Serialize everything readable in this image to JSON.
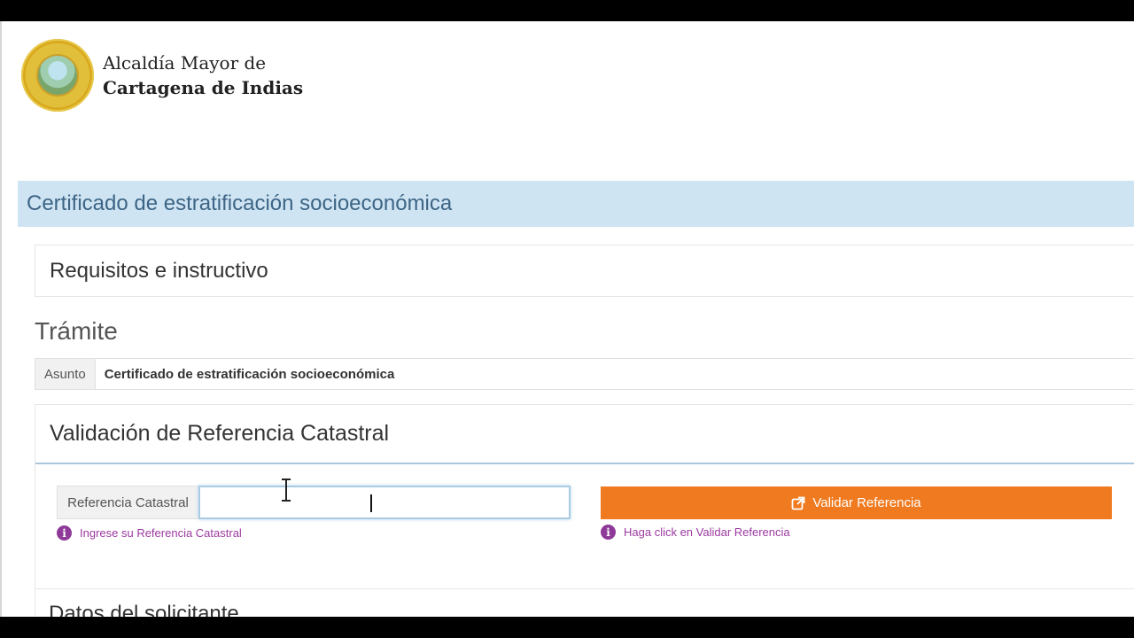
{
  "brand": {
    "line1": "Alcaldía Mayor de",
    "line2": "Cartagena de Indias",
    "seal_icon": "city-seal-icon"
  },
  "page_title": "Certificado de estratificación socioeconómica",
  "requirements": {
    "label": "Requisitos e instructivo"
  },
  "tramite": {
    "heading": "Trámite",
    "asunto_label": "Asunto",
    "asunto_value": "Certificado de estratificación socioeconómica"
  },
  "validation": {
    "heading": "Validación de Referencia Catastral",
    "ref_label": "Referencia Catastral",
    "ref_value": "",
    "ref_help": "Ingrese su Referencia Catastral",
    "button_label": "Validar Referencia",
    "button_help": "Haga click en Validar Referencia",
    "button_icon": "external-link-icon",
    "help_icon": "info-icon"
  },
  "next_section": {
    "heading": "Datos del solicitante"
  },
  "colors": {
    "title_band": "#cfe4f3",
    "button": "#f07a1f",
    "help_text": "#9b3aa0"
  }
}
